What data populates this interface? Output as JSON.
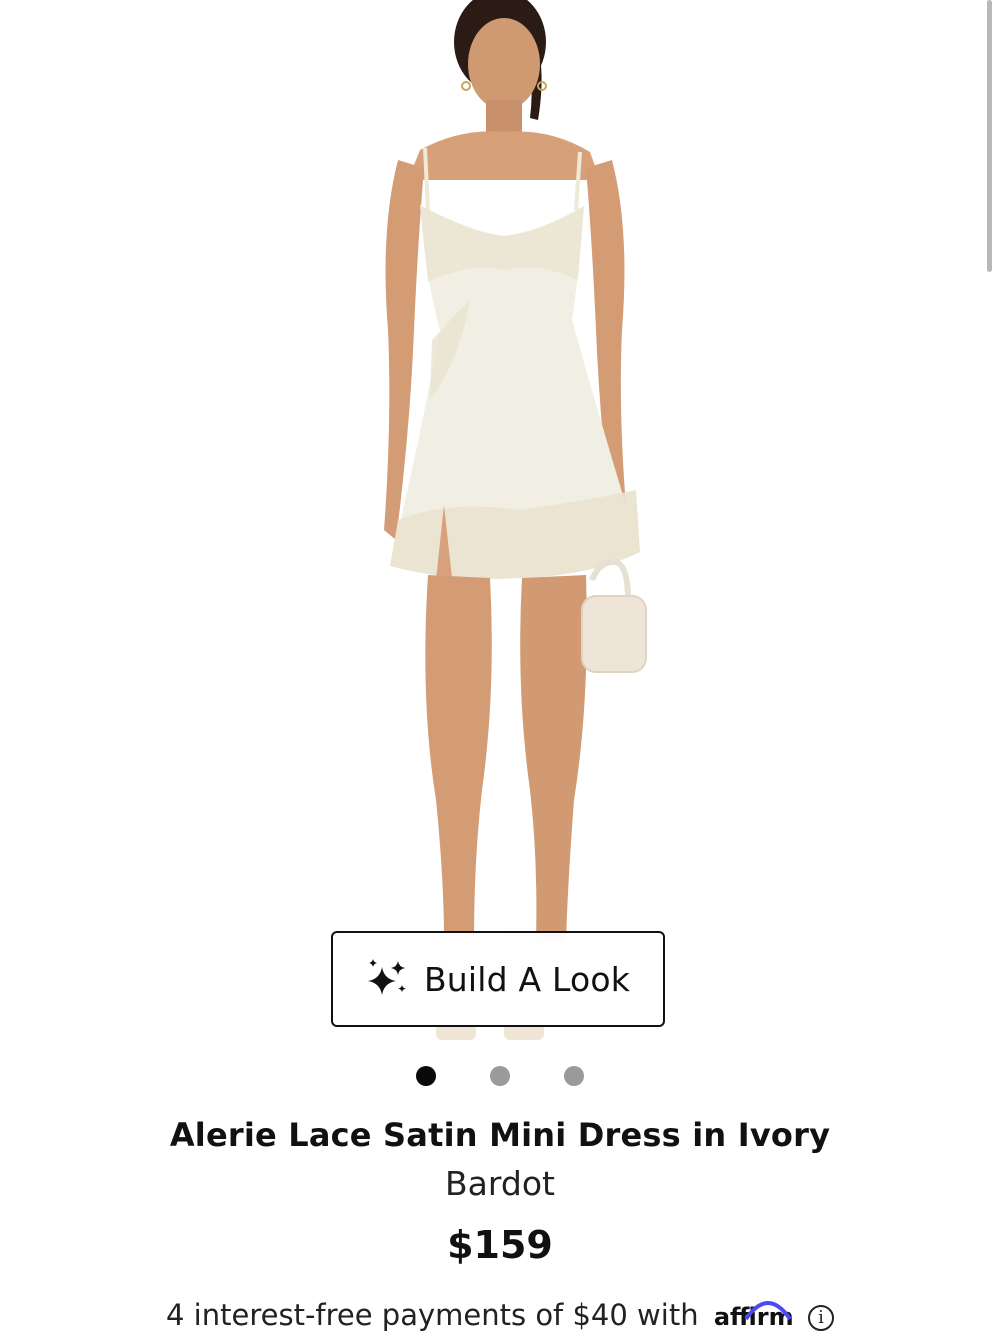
{
  "product": {
    "image_alt": "Model wearing ivory lace satin mini dress",
    "build_look_label": "Build A Look",
    "build_look_icon": "sparkle-icon",
    "carousel": {
      "total": 3,
      "active_index": 0
    },
    "title": "Alerie Lace Satin Mini Dress in Ivory",
    "brand": "Bardot",
    "price": "$159",
    "financing": {
      "text": "4 interest-free payments of $40 with",
      "provider": "affirm",
      "info_icon": "info-icon"
    }
  },
  "colors": {
    "background": "#ffffff",
    "text": "#111111",
    "dot_active": "#0a0a0a",
    "dot_inactive": "#9a9a9a",
    "dress": "#f1efe3",
    "skin": "#d9a57e",
    "affirm_arc": "#4a4af4"
  }
}
